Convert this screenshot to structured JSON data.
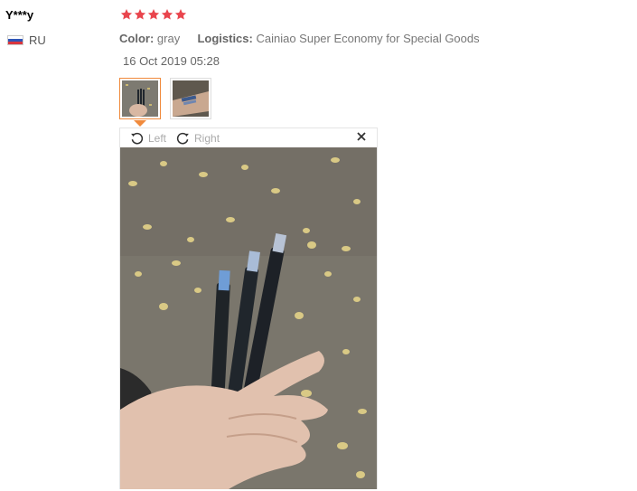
{
  "review": {
    "user_name": "Y***y",
    "country_code": "RU",
    "rating": 5,
    "color_label": "Color:",
    "color_value": "gray",
    "logistics_label": "Logistics:",
    "logistics_value": "Cainiao Super Economy for Special Goods",
    "date": "16 Oct 2019 05:28"
  },
  "viewer": {
    "rotate_left_label": "Left",
    "rotate_right_label": "Right"
  },
  "icons": {
    "star": "star-icon",
    "flag": "russia-flag-icon",
    "rotate_left": "rotate-left-icon",
    "rotate_right": "rotate-right-icon",
    "close": "close-icon"
  },
  "colors": {
    "star": "#e9454d",
    "thumb_active_border": "#f08a3c",
    "toolbar_text": "#aaaaaa"
  }
}
